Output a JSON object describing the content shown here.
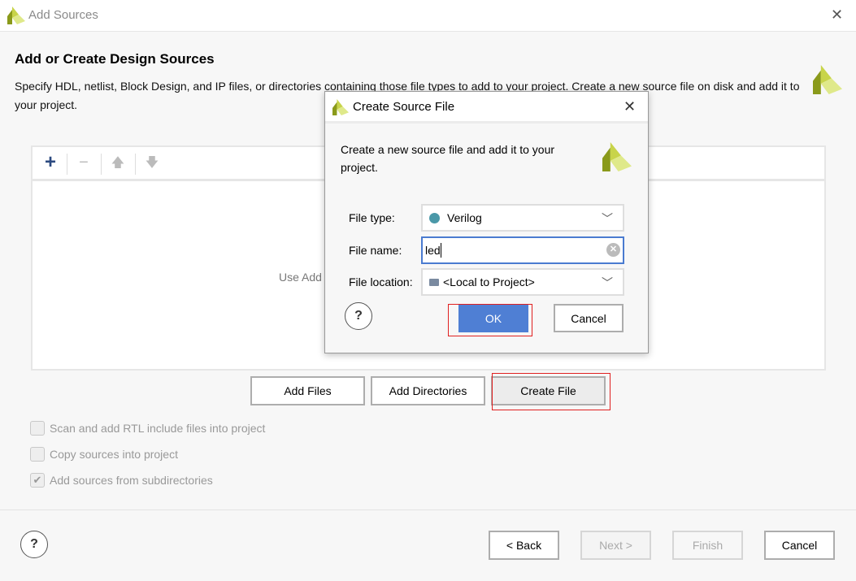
{
  "window": {
    "title": "Add Sources",
    "close_icon": "close-icon",
    "logo": "xilinx-logo"
  },
  "page": {
    "heading": "Add or Create Design Sources",
    "description": "Specify HDL, netlist, Block Design, and IP files, or directories containing those file types to add to your project. Create a new source file on disk and add it to your project."
  },
  "toolbar": {
    "add": "+",
    "remove": "−",
    "up": "🡅",
    "down": "🡇"
  },
  "list": {
    "hint": "Use Add Files, Add Directories or Create File buttons below"
  },
  "buttons": {
    "add_files": "Add Files",
    "add_directories": "Add Directories",
    "create_file": "Create File"
  },
  "options": [
    {
      "label": "Scan and add RTL include files into project",
      "checked": false,
      "enabled": false
    },
    {
      "label": "Copy sources into project",
      "checked": false,
      "enabled": false
    },
    {
      "label": "Add sources from subdirectories",
      "checked": true,
      "enabled": false
    }
  ],
  "footer": {
    "help": "?",
    "back": "< Back",
    "next": "Next >",
    "finish": "Finish",
    "cancel": "Cancel"
  },
  "dialog": {
    "title": "Create Source File",
    "description": "Create a new source file and add it to your project.",
    "file_type_label": "File type:",
    "file_type_value": "Verilog",
    "file_type_color": "#4a98a8",
    "file_name_label": "File name:",
    "file_name_value": "led",
    "file_location_label": "File location:",
    "file_location_value": "<Local to Project>",
    "help": "?",
    "ok": "OK",
    "cancel": "Cancel",
    "ok_color": "#4f7fd4"
  },
  "colors": {
    "highlight_box": "#e02020",
    "logo_dark": "#8a9a1a",
    "logo_light": "#d6e36a"
  }
}
